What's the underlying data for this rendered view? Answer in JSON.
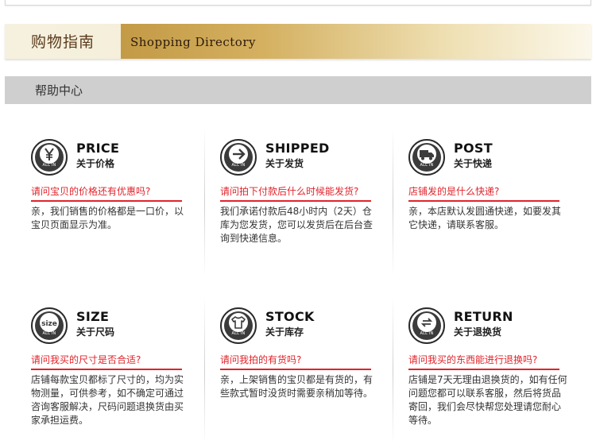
{
  "banner": {
    "title_cn": "购物指南",
    "title_en": "Shopping Directory"
  },
  "help": {
    "title": "帮助中心"
  },
  "cards": [
    {
      "en": "PRICE",
      "cn": "关于价格",
      "icon": "yen-icon",
      "badge": "ALL IN",
      "question": "请问宝贝的价格还有优惠吗?",
      "answer": "亲，我们销售的价格都是一口价，以宝贝页面显示为准。"
    },
    {
      "en": "SHIPPED",
      "cn": "关于发货",
      "icon": "arrow-right-icon",
      "badge": "ALL IN",
      "question": "请问拍下付款后什么时候能发货?",
      "answer": "我们承诺付款后48小时内（2天）仓库为您发货，您可以发货后在后台查询到快递信息。"
    },
    {
      "en": "POST",
      "cn": "关于快递",
      "icon": "truck-icon",
      "badge": "ALL IN",
      "question": "店铺发的是什么快递?",
      "answer": "亲，本店默认发圆通快递，如要发其它快递，请联系客服。"
    },
    {
      "en": "SIZE",
      "cn": "关于尺码",
      "icon": "size-icon",
      "badge": "ALL IN",
      "icon_text": "size",
      "question": "请问我买的尺寸是否合适?",
      "answer": "店铺每款宝贝都标了尺寸的，均为实物测量，可供参考，如不确定可通过咨询客服解决，尺码问题退换货由买家承担运费。"
    },
    {
      "en": "STOCK",
      "cn": "关于库存",
      "icon": "tshirt-icon",
      "badge": "ALL IN",
      "question": "请问我拍的有货吗?",
      "answer": "亲，上架销售的宝贝都是有货的，有些款式暂时没货时需要亲稍加等待。"
    },
    {
      "en": "RETURN",
      "cn": "关于退换货",
      "icon": "return-icon",
      "badge": "ALL IN",
      "question": "请问我买的东西能进行退换吗?",
      "answer": "店铺是7天无理由退换货的，如有任何问题您都可以联系客服，然后将货品寄回，我们会尽快帮您处理请您耐心等待。"
    }
  ]
}
